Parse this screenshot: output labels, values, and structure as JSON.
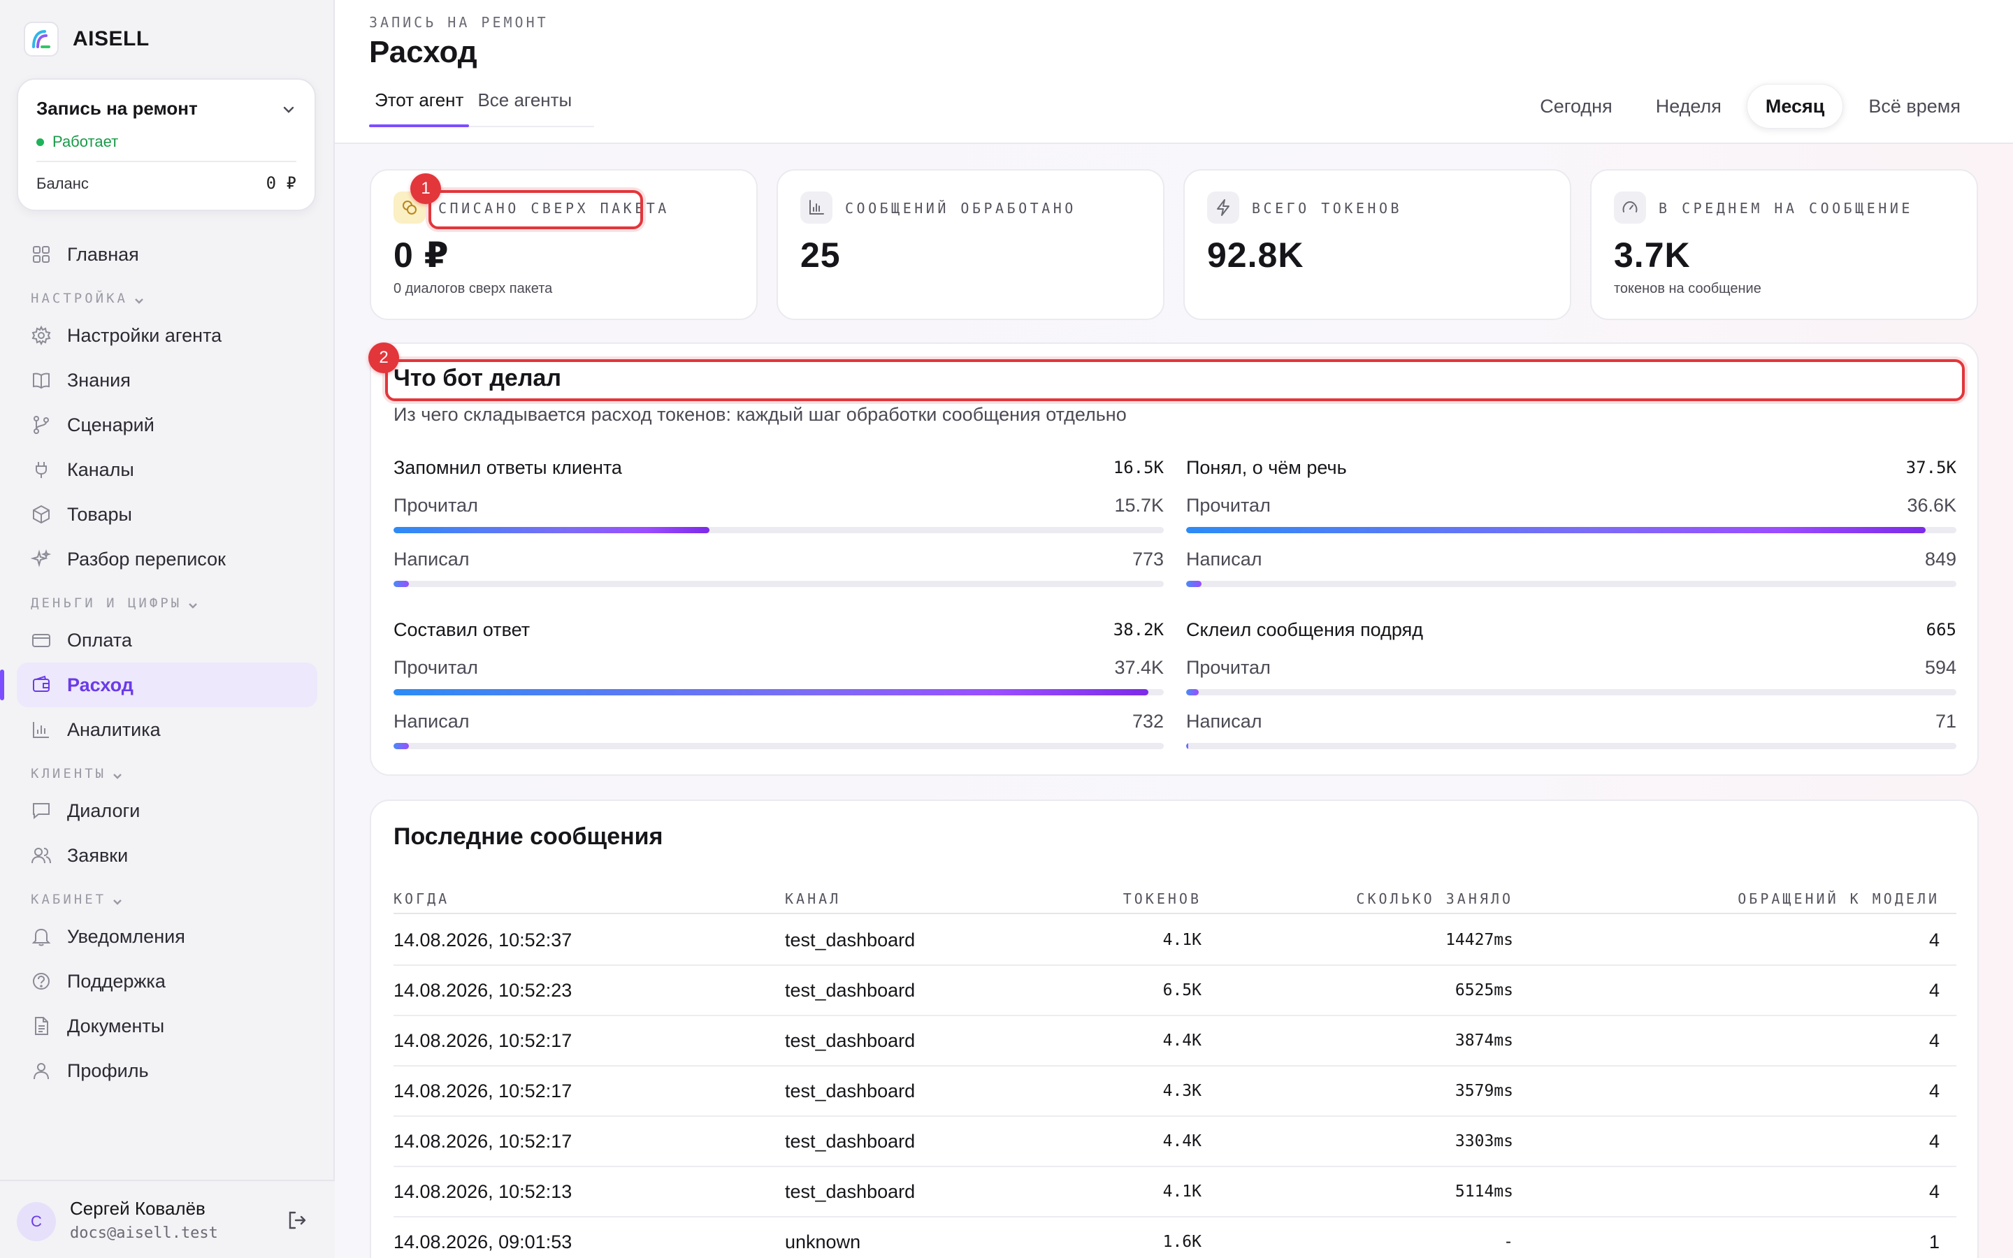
{
  "brand": {
    "name": "AISELL"
  },
  "agent": {
    "title": "Запись на ремонт",
    "status": "Работает",
    "balance_label": "Баланс",
    "balance_value": "0 ₽"
  },
  "nav": {
    "home": "Главная",
    "section_settings": "НАСТРОЙКА",
    "agent_settings": "Настройки агента",
    "knowledge": "Знания",
    "scenario": "Сценарий",
    "channels": "Каналы",
    "products": "Товары",
    "review": "Разбор переписок",
    "section_money": "ДЕНЬГИ И ЦИФРЫ",
    "payment": "Оплата",
    "expense": "Расход",
    "analytics": "Аналитика",
    "section_clients": "КЛИЕНТЫ",
    "dialogs": "Диалоги",
    "requests": "Заявки",
    "section_account": "КАБИНЕТ",
    "notifications": "Уведомления",
    "support": "Поддержка",
    "documents": "Документы",
    "profile": "Профиль"
  },
  "user": {
    "initial": "С",
    "name": "Сергей Ковалёв",
    "email": "docs@aisell.test"
  },
  "header": {
    "crumb": "ЗАПИСЬ НА РЕМОНТ",
    "title": "Расход",
    "tabs": [
      "Этот агент",
      "Все агенты"
    ],
    "active_tab": "Этот агент",
    "periods": [
      "Сегодня",
      "Неделя",
      "Месяц",
      "Всё время"
    ],
    "active_period": "Месяц"
  },
  "stats": [
    {
      "label": "СПИСАНО СВЕРХ ПАКЕТА",
      "value": "0 ₽",
      "sub": "0 диалогов сверх пакета",
      "icon": "coins-icon"
    },
    {
      "label": "СООБЩЕНИЙ ОБРАБОТАНО",
      "value": "25",
      "sub": "",
      "icon": "bar-chart-icon"
    },
    {
      "label": "ВСЕГО ТОКЕНОВ",
      "value": "92.8K",
      "sub": "",
      "icon": "lightning-icon"
    },
    {
      "label": "В СРЕДНЕМ НА СООБЩЕНИЕ",
      "value": "3.7K",
      "sub": "токенов на сообщение",
      "icon": "gauge-icon"
    }
  ],
  "markers": [
    "1",
    "2"
  ],
  "breakdown": {
    "title": "Что бот делал",
    "subtitle": "Из чего складывается расход токенов: каждый шаг обработки сообщения отдельно",
    "read_label": "Прочитал",
    "wrote_label": "Написал",
    "groups": [
      {
        "title": "Запомнил ответы клиента",
        "total": "16.5K",
        "read": "15.7K",
        "wrote": "773",
        "read_fraction": 0.41,
        "wrote_fraction": 0.02
      },
      {
        "title": "Понял, о чём речь",
        "total": "37.5K",
        "read": "36.6K",
        "wrote": "849",
        "read_fraction": 0.96,
        "wrote_fraction": 0.02
      },
      {
        "title": "Составил ответ",
        "total": "38.2K",
        "read": "37.4K",
        "wrote": "732",
        "read_fraction": 0.98,
        "wrote_fraction": 0.02
      },
      {
        "title": "Склеил сообщения подряд",
        "total": "665",
        "read": "594",
        "wrote": "71",
        "read_fraction": 0.016,
        "wrote_fraction": 0.002
      }
    ]
  },
  "messages": {
    "title": "Последние сообщения",
    "columns": [
      "КОГДА",
      "КАНАЛ",
      "ТОКЕНОВ",
      "СКОЛЬКО ЗАНЯЛО",
      "ОБРАЩЕНИЙ К МОДЕЛИ"
    ],
    "rows": [
      {
        "when": "14.08.2026, 10:52:37",
        "channel": "test_dashboard",
        "tokens": "4.1K",
        "duration": "14427ms",
        "calls": "4"
      },
      {
        "when": "14.08.2026, 10:52:23",
        "channel": "test_dashboard",
        "tokens": "6.5K",
        "duration": "6525ms",
        "calls": "4"
      },
      {
        "when": "14.08.2026, 10:52:17",
        "channel": "test_dashboard",
        "tokens": "4.4K",
        "duration": "3874ms",
        "calls": "4"
      },
      {
        "when": "14.08.2026, 10:52:17",
        "channel": "test_dashboard",
        "tokens": "4.3K",
        "duration": "3579ms",
        "calls": "4"
      },
      {
        "when": "14.08.2026, 10:52:17",
        "channel": "test_dashboard",
        "tokens": "4.4K",
        "duration": "3303ms",
        "calls": "4"
      },
      {
        "when": "14.08.2026, 10:52:13",
        "channel": "test_dashboard",
        "tokens": "4.1K",
        "duration": "5114ms",
        "calls": "4"
      },
      {
        "when": "14.08.2026, 09:01:53",
        "channel": "unknown",
        "tokens": "1.6K",
        "duration": "-",
        "calls": "1"
      }
    ]
  },
  "colors": {
    "accent": "#7c4dff",
    "status_green": "#1fb25a",
    "marker_red": "#e2363b"
  }
}
